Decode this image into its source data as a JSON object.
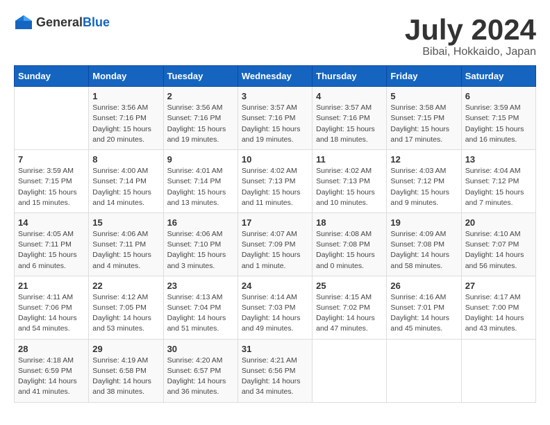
{
  "header": {
    "logo_general": "General",
    "logo_blue": "Blue",
    "month": "July 2024",
    "location": "Bibai, Hokkaido, Japan"
  },
  "days_of_week": [
    "Sunday",
    "Monday",
    "Tuesday",
    "Wednesday",
    "Thursday",
    "Friday",
    "Saturday"
  ],
  "weeks": [
    [
      {
        "date": "",
        "content": ""
      },
      {
        "date": "1",
        "content": "Sunrise: 3:56 AM\nSunset: 7:16 PM\nDaylight: 15 hours\nand 20 minutes."
      },
      {
        "date": "2",
        "content": "Sunrise: 3:56 AM\nSunset: 7:16 PM\nDaylight: 15 hours\nand 19 minutes."
      },
      {
        "date": "3",
        "content": "Sunrise: 3:57 AM\nSunset: 7:16 PM\nDaylight: 15 hours\nand 19 minutes."
      },
      {
        "date": "4",
        "content": "Sunrise: 3:57 AM\nSunset: 7:16 PM\nDaylight: 15 hours\nand 18 minutes."
      },
      {
        "date": "5",
        "content": "Sunrise: 3:58 AM\nSunset: 7:15 PM\nDaylight: 15 hours\nand 17 minutes."
      },
      {
        "date": "6",
        "content": "Sunrise: 3:59 AM\nSunset: 7:15 PM\nDaylight: 15 hours\nand 16 minutes."
      }
    ],
    [
      {
        "date": "7",
        "content": "Sunrise: 3:59 AM\nSunset: 7:15 PM\nDaylight: 15 hours\nand 15 minutes."
      },
      {
        "date": "8",
        "content": "Sunrise: 4:00 AM\nSunset: 7:14 PM\nDaylight: 15 hours\nand 14 minutes."
      },
      {
        "date": "9",
        "content": "Sunrise: 4:01 AM\nSunset: 7:14 PM\nDaylight: 15 hours\nand 13 minutes."
      },
      {
        "date": "10",
        "content": "Sunrise: 4:02 AM\nSunset: 7:13 PM\nDaylight: 15 hours\nand 11 minutes."
      },
      {
        "date": "11",
        "content": "Sunrise: 4:02 AM\nSunset: 7:13 PM\nDaylight: 15 hours\nand 10 minutes."
      },
      {
        "date": "12",
        "content": "Sunrise: 4:03 AM\nSunset: 7:12 PM\nDaylight: 15 hours\nand 9 minutes."
      },
      {
        "date": "13",
        "content": "Sunrise: 4:04 AM\nSunset: 7:12 PM\nDaylight: 15 hours\nand 7 minutes."
      }
    ],
    [
      {
        "date": "14",
        "content": "Sunrise: 4:05 AM\nSunset: 7:11 PM\nDaylight: 15 hours\nand 6 minutes."
      },
      {
        "date": "15",
        "content": "Sunrise: 4:06 AM\nSunset: 7:11 PM\nDaylight: 15 hours\nand 4 minutes."
      },
      {
        "date": "16",
        "content": "Sunrise: 4:06 AM\nSunset: 7:10 PM\nDaylight: 15 hours\nand 3 minutes."
      },
      {
        "date": "17",
        "content": "Sunrise: 4:07 AM\nSunset: 7:09 PM\nDaylight: 15 hours\nand 1 minute."
      },
      {
        "date": "18",
        "content": "Sunrise: 4:08 AM\nSunset: 7:08 PM\nDaylight: 15 hours\nand 0 minutes."
      },
      {
        "date": "19",
        "content": "Sunrise: 4:09 AM\nSunset: 7:08 PM\nDaylight: 14 hours\nand 58 minutes."
      },
      {
        "date": "20",
        "content": "Sunrise: 4:10 AM\nSunset: 7:07 PM\nDaylight: 14 hours\nand 56 minutes."
      }
    ],
    [
      {
        "date": "21",
        "content": "Sunrise: 4:11 AM\nSunset: 7:06 PM\nDaylight: 14 hours\nand 54 minutes."
      },
      {
        "date": "22",
        "content": "Sunrise: 4:12 AM\nSunset: 7:05 PM\nDaylight: 14 hours\nand 53 minutes."
      },
      {
        "date": "23",
        "content": "Sunrise: 4:13 AM\nSunset: 7:04 PM\nDaylight: 14 hours\nand 51 minutes."
      },
      {
        "date": "24",
        "content": "Sunrise: 4:14 AM\nSunset: 7:03 PM\nDaylight: 14 hours\nand 49 minutes."
      },
      {
        "date": "25",
        "content": "Sunrise: 4:15 AM\nSunset: 7:02 PM\nDaylight: 14 hours\nand 47 minutes."
      },
      {
        "date": "26",
        "content": "Sunrise: 4:16 AM\nSunset: 7:01 PM\nDaylight: 14 hours\nand 45 minutes."
      },
      {
        "date": "27",
        "content": "Sunrise: 4:17 AM\nSunset: 7:00 PM\nDaylight: 14 hours\nand 43 minutes."
      }
    ],
    [
      {
        "date": "28",
        "content": "Sunrise: 4:18 AM\nSunset: 6:59 PM\nDaylight: 14 hours\nand 41 minutes."
      },
      {
        "date": "29",
        "content": "Sunrise: 4:19 AM\nSunset: 6:58 PM\nDaylight: 14 hours\nand 38 minutes."
      },
      {
        "date": "30",
        "content": "Sunrise: 4:20 AM\nSunset: 6:57 PM\nDaylight: 14 hours\nand 36 minutes."
      },
      {
        "date": "31",
        "content": "Sunrise: 4:21 AM\nSunset: 6:56 PM\nDaylight: 14 hours\nand 34 minutes."
      },
      {
        "date": "",
        "content": ""
      },
      {
        "date": "",
        "content": ""
      },
      {
        "date": "",
        "content": ""
      }
    ]
  ]
}
